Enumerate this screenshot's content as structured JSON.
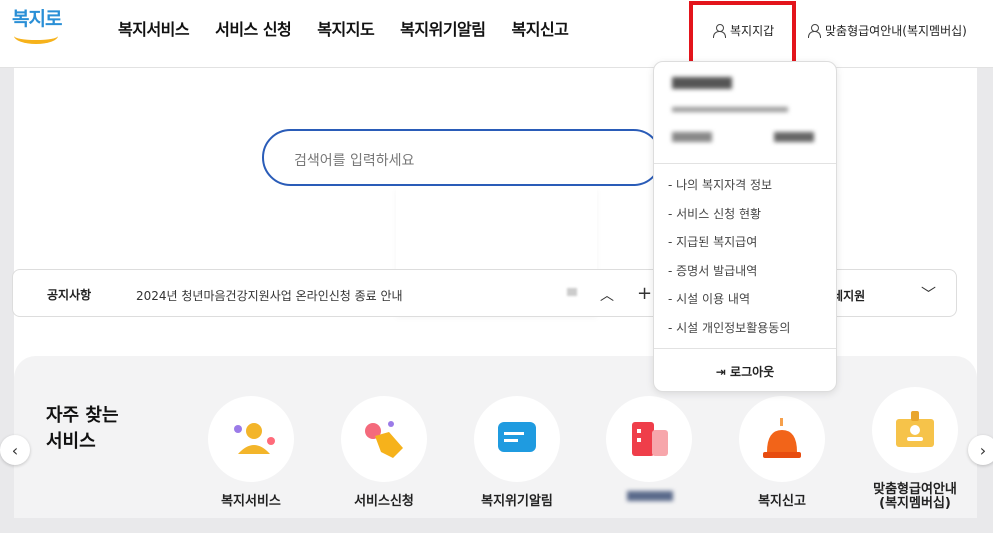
{
  "brand": {
    "logo_text": "복지로",
    "accent": "#2a8fd6",
    "smile": "#f6b21b"
  },
  "nav": [
    {
      "label": "복지서비스"
    },
    {
      "label": "서비스 신청"
    },
    {
      "label": "복지지도"
    },
    {
      "label": "복지위기알림"
    },
    {
      "label": "복지신고"
    }
  ],
  "header": {
    "wallet_label": "복지지갑",
    "custom_label": "맞춤형급여안내(복지멤버십)",
    "highlight_color": "#e3141b"
  },
  "search": {
    "placeholder": "검색어를 입력하세요"
  },
  "notice": {
    "label": "공지사항",
    "text": "2024년 청년마음건강지원사업 온라인신청 종료 안내",
    "right_label": "월세지원"
  },
  "frequent": {
    "title": "자주 찾는 서비스",
    "items": [
      {
        "label": "복지서비스",
        "icon": "person-icon"
      },
      {
        "label": "서비스신청",
        "icon": "hand-click-icon"
      },
      {
        "label": "복지위기알림",
        "icon": "chat-bubble-icon"
      },
      {
        "label": "",
        "icon": "building-icon"
      },
      {
        "label": "복지신고",
        "icon": "siren-icon"
      },
      {
        "label": "맞춤형급여안내\n(복지멤버십)",
        "icon": "member-card-icon"
      }
    ]
  },
  "dropdown": {
    "menu": [
      "- 나의 복지자격 정보",
      "- 서비스 신청 현황",
      "- 지급된 복지급여",
      "- 증명서 발급내역",
      "- 시설 이용 내역",
      "- 시설 개인정보활용동의"
    ],
    "logout_label": "로그아웃"
  }
}
